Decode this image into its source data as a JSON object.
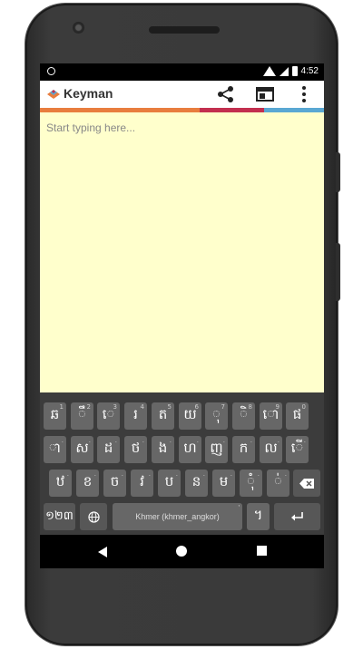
{
  "statusbar": {
    "time": "4:52"
  },
  "appbar": {
    "title": "Keyman",
    "actions": [
      "share-icon",
      "web-browser-icon",
      "overflow-menu-icon"
    ]
  },
  "colors": {
    "bar1": "#e87d3e",
    "bar2": "#c32f4f",
    "bar3": "#5aa8d3",
    "editor_bg": "#ffffcc",
    "keyboard_bg": "#3c3c3c",
    "key_bg": "#676767"
  },
  "editor": {
    "placeholder": "Start typing here..."
  },
  "keyboard": {
    "row1": [
      {
        "label": "ឆ",
        "hint": "1"
      },
      {
        "label": "ឹ",
        "hint": "2"
      },
      {
        "label": "េ",
        "hint": "3"
      },
      {
        "label": "រ",
        "hint": "4"
      },
      {
        "label": "ត",
        "hint": "5"
      },
      {
        "label": "យ",
        "hint": "6"
      },
      {
        "label": "ុ",
        "hint": "7"
      },
      {
        "label": "ិ",
        "hint": "8"
      },
      {
        "label": "ោ",
        "hint": "9"
      },
      {
        "label": "ផ",
        "hint": "0"
      }
    ],
    "row2": [
      {
        "label": "ា",
        "hint": "."
      },
      {
        "label": "ស",
        "hint": "."
      },
      {
        "label": "ដ",
        "hint": "."
      },
      {
        "label": "ថ",
        "hint": "."
      },
      {
        "label": "ង",
        "hint": "."
      },
      {
        "label": "ហ",
        "hint": "."
      },
      {
        "label": "ញ",
        "hint": "."
      },
      {
        "label": "ក",
        "hint": "."
      },
      {
        "label": "ល",
        "hint": "."
      },
      {
        "label": "ើ",
        "hint": "."
      }
    ],
    "row3": [
      {
        "label": "ឋ",
        "hint": "."
      },
      {
        "label": "ខ",
        "hint": "."
      },
      {
        "label": "ច",
        "hint": "."
      },
      {
        "label": "វ",
        "hint": "."
      },
      {
        "label": "ប",
        "hint": "."
      },
      {
        "label": "ន",
        "hint": "."
      },
      {
        "label": "ម",
        "hint": "."
      },
      {
        "label": "ុំ",
        "hint": "."
      },
      {
        "label": "់",
        "hint": "."
      }
    ],
    "numbers_key": "១២៣",
    "space_label": "Khmer (khmer_angkor)",
    "period_key": "។"
  }
}
